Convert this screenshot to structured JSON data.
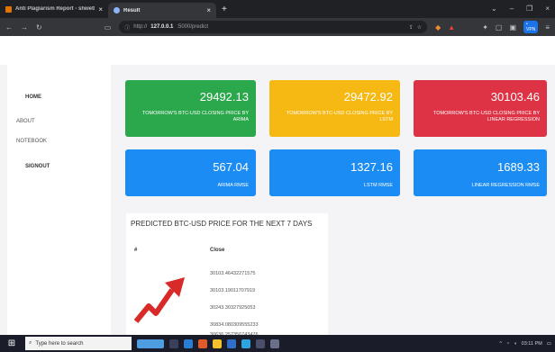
{
  "browser": {
    "tabs": [
      {
        "label": "Anti Plagiarism Report - shwetharda",
        "active": false
      },
      {
        "label": "Result",
        "active": true
      }
    ],
    "new_tab": "+",
    "url": {
      "host": "127.0.0.1",
      "rest": ":5000/predict",
      "prefix": "http://"
    },
    "vpn": "• VPN"
  },
  "sidebar": {
    "items": [
      "HOME",
      "ABOUT",
      "NOTEBOOK",
      "SIGNOUT"
    ]
  },
  "cards": [
    {
      "value": "29492.13",
      "caption": "TOMORROW'S BTC-USD CLOSING PRICE BY ARIMA",
      "color": "#2ca84c"
    },
    {
      "value": "29472.92",
      "caption": "TOMORROW'S BTC-USD CLOSING PRICE BY LSTM",
      "color": "#f6b813"
    },
    {
      "value": "30103.46",
      "caption": "TOMORROW'S BTC-USD CLOSING PRICE BY LINEAR REGRESSION",
      "color": "#dd3345"
    },
    {
      "value": "567.04",
      "caption": "ARIMA RMSE",
      "color": "#1c8cf5"
    },
    {
      "value": "1327.16",
      "caption": "LSTM RMSE",
      "color": "#1c8cf5"
    },
    {
      "value": "1689.33",
      "caption": "LINEAR REGRESSION RMSE",
      "color": "#1c8cf5"
    }
  ],
  "prediction": {
    "title": "PREDICTED BTC-USD PRICE FOR THE NEXT 7 DAYS",
    "columns": [
      "#",
      "Close"
    ],
    "values": [
      "30103.46432271575",
      "30103.19011707919",
      "30243.30327925053",
      "30834.080309555233",
      "30636.257356743476"
    ]
  },
  "taskbar": {
    "search_placeholder": "Type here to search",
    "time": "03:11 PM"
  },
  "icons": [
    "search-icon",
    "windows-icon",
    "back-icon",
    "forward-icon",
    "reload-icon",
    "trend-arrow-icon"
  ]
}
